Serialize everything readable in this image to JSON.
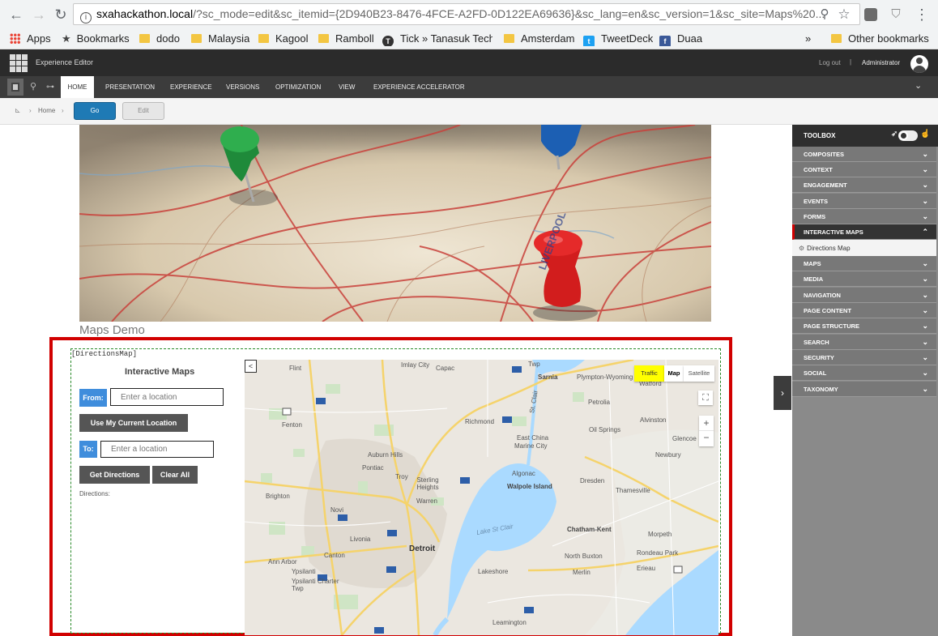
{
  "browser": {
    "url_host": "sxahackathon.local",
    "url_rest": "/?sc_mode=edit&sc_itemid={2D940B23-8476-4FCE-A2FD-0D122EA69636}&sc_lang=en&sc_version=1&sc_site=Maps%20...",
    "bookmarks": [
      {
        "label": "Apps",
        "icon": "apps-grid-icon"
      },
      {
        "label": "Bookmarks",
        "icon": "star-icon"
      },
      {
        "label": "dodo",
        "icon": "folder-icon"
      },
      {
        "label": "Malaysia",
        "icon": "folder-icon"
      },
      {
        "label": "Kagool",
        "icon": "folder-icon"
      },
      {
        "label": "Ramboll",
        "icon": "folder-icon"
      },
      {
        "label": "Tick » Tanasuk Techno",
        "icon": "tick-logo-icon"
      },
      {
        "label": "Amsterdam",
        "icon": "folder-icon"
      },
      {
        "label": "TweetDeck",
        "icon": "tweetdeck-icon"
      },
      {
        "label": "Duaa",
        "icon": "facebook-icon"
      }
    ],
    "overflow": "»",
    "other_bookmarks": "Other bookmarks"
  },
  "editor": {
    "title": "Experience Editor",
    "logout": "Log out",
    "separator": "|",
    "user": "Administrator",
    "tabs": [
      "HOME",
      "PRESENTATION",
      "EXPERIENCE",
      "VERSIONS",
      "OPTIMIZATION",
      "VIEW",
      "EXPERIENCE ACCELERATOR"
    ],
    "breadcrumb_home": "Home",
    "go_label": "Go",
    "edit_label": "Edit"
  },
  "page": {
    "heading": "Maps Demo",
    "component_tag": "[DirectionsMap]",
    "panel_title": "Interactive Maps",
    "from_label": "From:",
    "from_placeholder": "Enter a location",
    "use_location": "Use My Current Location",
    "to_label": "To:",
    "to_placeholder": "Enter a location",
    "get_directions": "Get Directions",
    "clear_all": "Clear All",
    "directions_label": "Directions:"
  },
  "map": {
    "collapse": "<",
    "traffic": "Traffic",
    "map_type": "Map",
    "satellite": "Satellite",
    "zoom_in": "+",
    "zoom_out": "−",
    "fullscreen": "⛶",
    "cities": [
      "Flint",
      "Imlay City",
      "Capac",
      "Sarnia",
      "Twp",
      "Plympton-Wyoming",
      "Watford",
      "Petrolia",
      "Fenton",
      "Richmond",
      "St. Clair",
      "Alvinston",
      "Oil Springs",
      "East China",
      "Marine City",
      "Glencoe",
      "Auburn Hills",
      "Pontiac",
      "Troy",
      "Algonac",
      "Newbury",
      "Sterling Heights",
      "Walpole Island",
      "Dresden",
      "Brighton",
      "Warren",
      "Thamesville",
      "Novi",
      "Lake St Clair",
      "Livonia",
      "Detroit",
      "Chatham-Kent",
      "Morpeth",
      "Canton",
      "Ann Arbor",
      "North Buxton",
      "Rondeau Park",
      "Ypsilanti",
      "Lakeshore",
      "Merlin",
      "Erieau",
      "Ypsilanti Charter Twp",
      "Leamington"
    ]
  },
  "toolbox": {
    "title": "TOOLBOX",
    "items": [
      "COMPOSITES",
      "CONTEXT",
      "ENGAGEMENT",
      "EVENTS",
      "FORMS",
      "INTERACTIVE MAPS",
      "MAPS",
      "MEDIA",
      "NAVIGATION",
      "PAGE CONTENT",
      "PAGE STRUCTURE",
      "SEARCH",
      "SECURITY",
      "SOCIAL",
      "TAXONOMY"
    ],
    "sub_item": "Directions Map",
    "active_index": 5
  },
  "colors": {
    "red_frame": "#d10000",
    "go_button": "#1f7ab5",
    "from_label_bg": "#3f8ddc",
    "traffic_bg": "#ffff00"
  }
}
